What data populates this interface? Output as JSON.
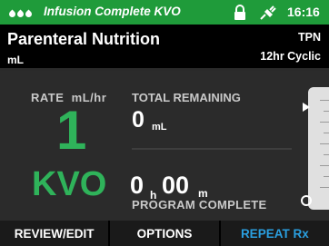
{
  "status_bar": {
    "title": "Infusion Complete KVO",
    "time": "16:16",
    "background_color": "#1f9b3a",
    "icons": [
      "drops-icon",
      "lock-icon",
      "ac-power-plug-icon"
    ]
  },
  "header": {
    "title": "Parenteral Nutrition",
    "subtitle": "mL",
    "therapy_label": "TPN",
    "mode_label": "12hr Cyclic"
  },
  "rate": {
    "label": "RATE  mL/hr",
    "value": "1",
    "mode": "KVO",
    "color": "#2fb35a"
  },
  "total_remaining": {
    "label": "TOTAL REMAINING",
    "value": "0",
    "unit": "mL"
  },
  "time_remaining": {
    "hours": "0",
    "hours_unit": "h",
    "minutes": "00",
    "minutes_unit": "m"
  },
  "program_status": "PROGRAM COMPLETE",
  "softkeys": {
    "review_edit": "REVIEW/EDIT",
    "options": "OPTIONS",
    "repeat_rx": "REPEAT Rx",
    "accent_color": "#2a9fe0"
  }
}
